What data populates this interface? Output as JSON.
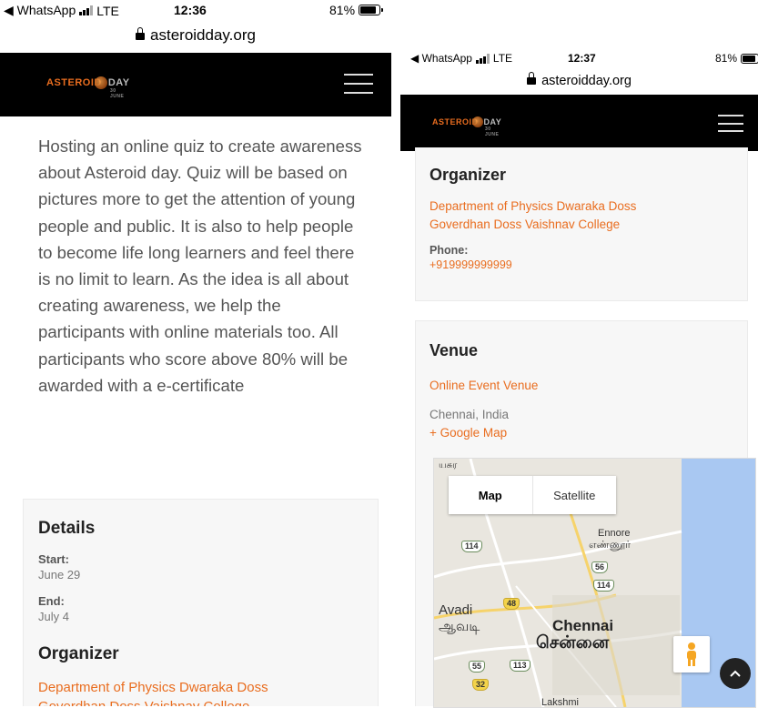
{
  "left_phone": {
    "status": {
      "back_app": "◀ WhatsApp",
      "network": "LTE",
      "time": "12:36",
      "battery": "81%"
    },
    "url": "asteroidday.org",
    "logo": {
      "part1": "ASTEROID",
      "part2": "DAY",
      "sub": "30 JUNE"
    },
    "description": "Hosting an online quiz to create awareness about Asteroid day. Quiz will be based on pictures more to get the attention of young people and public. It is also to help people to become life long learners and feel there is no limit to learn. As the idea is all about creating awareness, we help the participants with online materials too. All participants who score above 80% will be awarded with a e-certificate",
    "details": {
      "heading": "Details",
      "start_label": "Start:",
      "start_value": "June 29",
      "end_label": "End:",
      "end_value": "July 4"
    },
    "organizer": {
      "heading": "Organizer",
      "name_line1": "Department of Physics Dwaraka Doss",
      "name_line2": "Goverdhan Doss Vaishnav College"
    }
  },
  "right_phone": {
    "status": {
      "back_app": "◀ WhatsApp",
      "network": "LTE",
      "time": "12:37",
      "battery": "81%"
    },
    "url": "asteroidday.org",
    "logo": {
      "part1": "ASTEROID",
      "part2": "DAY",
      "sub": "30 JUNE"
    },
    "organizer": {
      "heading": "Organizer",
      "name_line1": "Department of Physics Dwaraka Doss",
      "name_line2": "Goverdhan Doss Vaishnav College",
      "phone_label": "Phone:",
      "phone_value": "+919999999999"
    },
    "venue": {
      "heading": "Venue",
      "name": "Online Event Venue",
      "location": "Chennai, India",
      "map_link": "+ Google Map"
    },
    "map": {
      "tab_map": "Map",
      "tab_satellite": "Satellite",
      "labels": {
        "ennore": "Ennore",
        "ennore_tamil": "எண்ணூர்",
        "avadi": "Avadi",
        "avadi_tamil": "ஆவடி",
        "chennai": "Chennai",
        "chennai_tamil": "சென்னை",
        "lakshmi": "Lakshmi",
        "top_partial": "யசுர"
      },
      "shields": [
        "114",
        "56",
        "114",
        "48",
        "55",
        "113",
        "32"
      ]
    }
  },
  "colors": {
    "accent": "#e96d1f",
    "header": "#000000",
    "card_bg": "#f7f7f7",
    "sea": "#a9c8f2"
  }
}
